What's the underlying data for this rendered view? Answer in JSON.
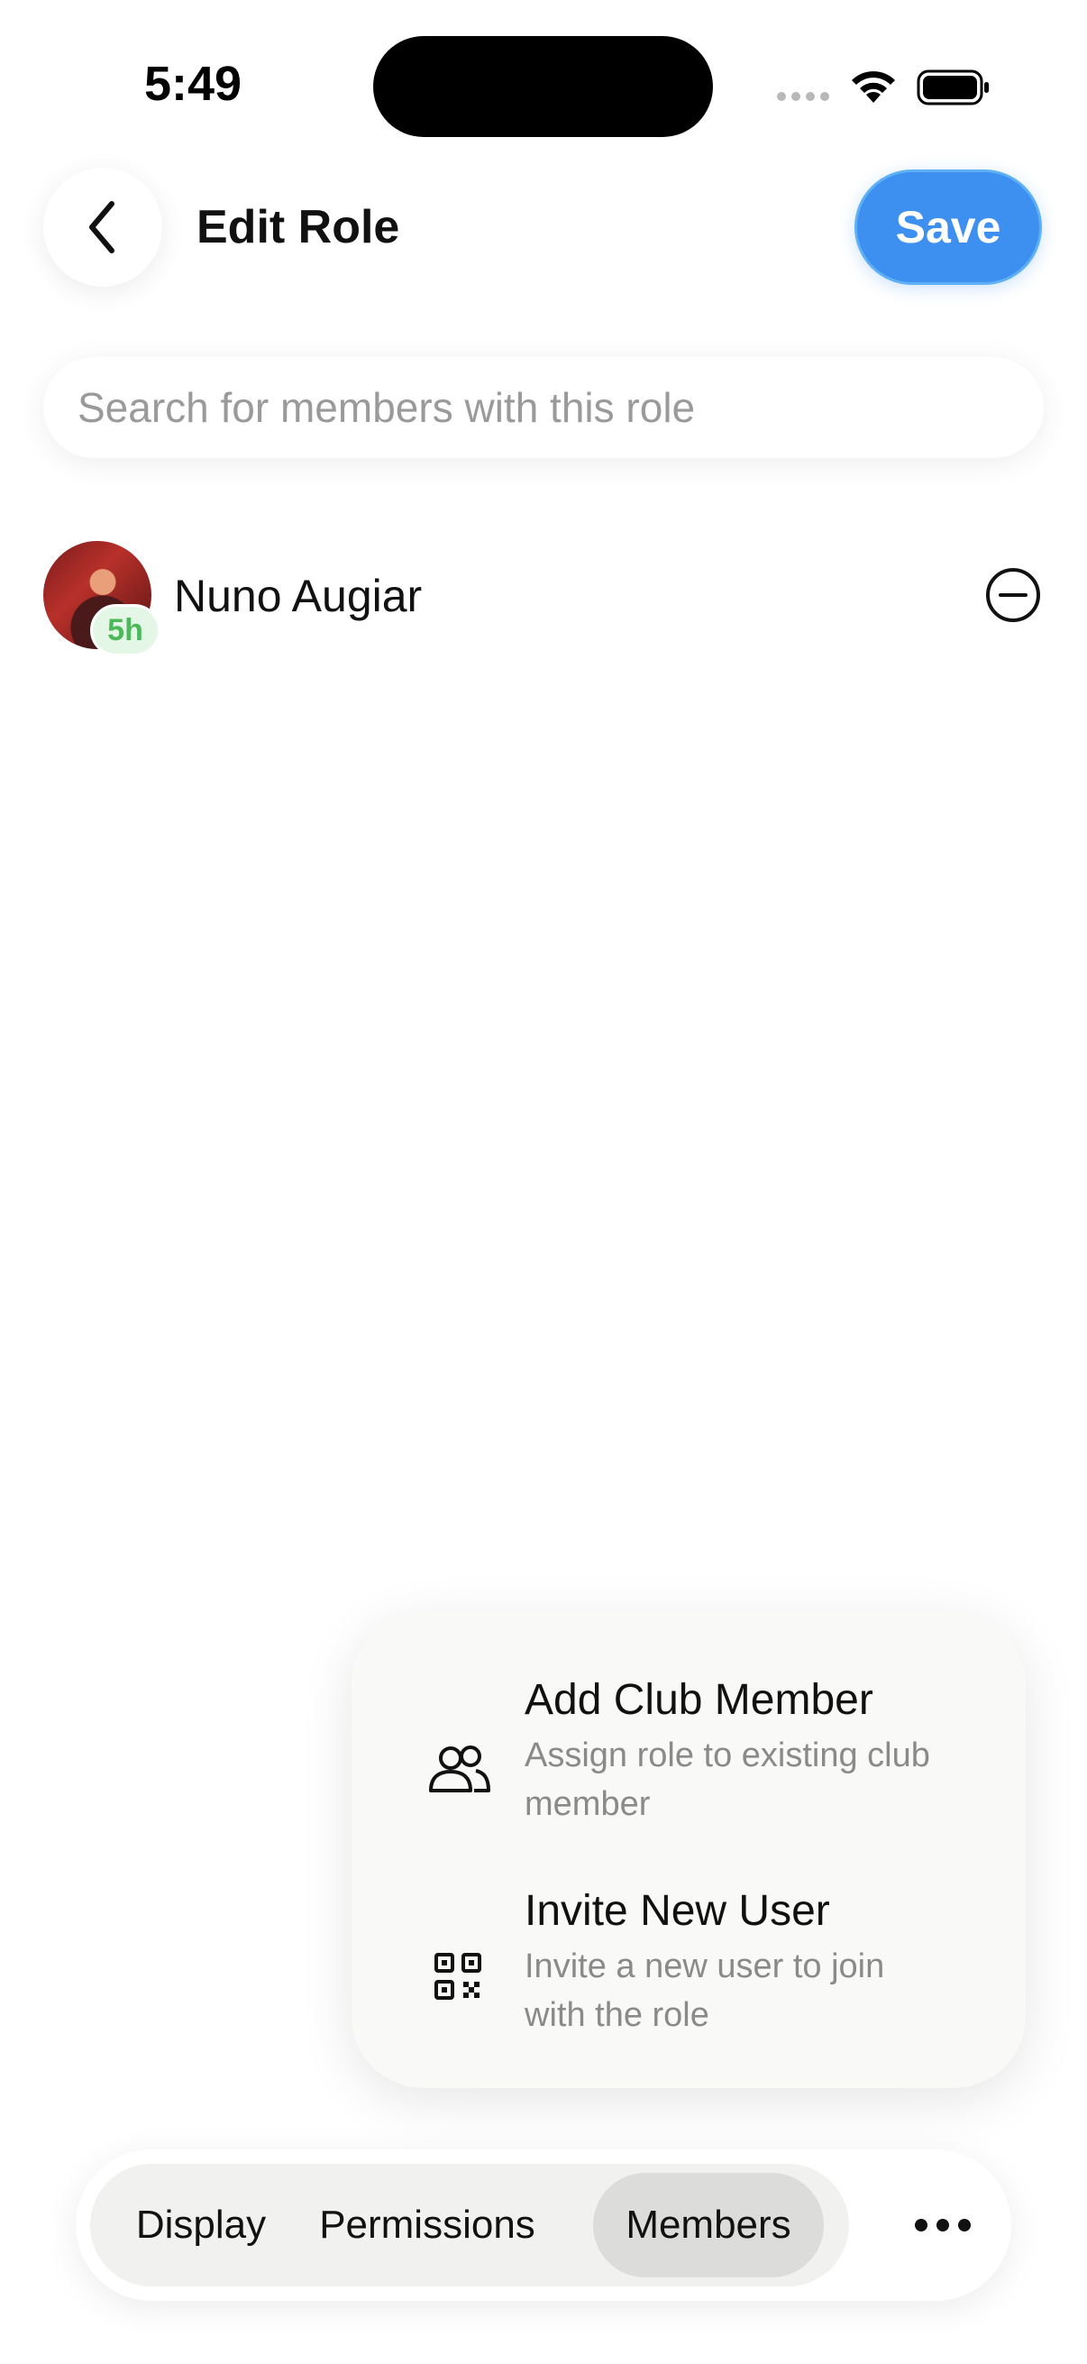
{
  "status_bar": {
    "time": "5:49",
    "icons": [
      "cellular-signal-icon",
      "wifi-icon",
      "battery-icon"
    ]
  },
  "header": {
    "back_icon": "chevron-left-icon",
    "title": "Edit Role",
    "save_label": "Save"
  },
  "search": {
    "placeholder": "Search for members with this role",
    "value": ""
  },
  "members": [
    {
      "name": "Nuno Augiar",
      "badge": "5h",
      "action_icon": "minus-circle-icon"
    }
  ],
  "menu": {
    "items": [
      {
        "icon": "people-icon",
        "label": "Add Club Member",
        "description": "Assign role to existing club member"
      },
      {
        "icon": "qr-code-icon",
        "label": "Invite New User",
        "description": "Invite a new user to join with the role"
      }
    ]
  },
  "tabs": {
    "items": [
      {
        "label": "Display",
        "active": false
      },
      {
        "label": "Permissions",
        "active": false
      },
      {
        "label": "Members",
        "active": true
      }
    ],
    "more_icon": "more-horizontal-icon"
  },
  "colors": {
    "accent": "#3d8ff0",
    "badge_text": "#4bb85a",
    "badge_bg": "#e4f6e6"
  }
}
